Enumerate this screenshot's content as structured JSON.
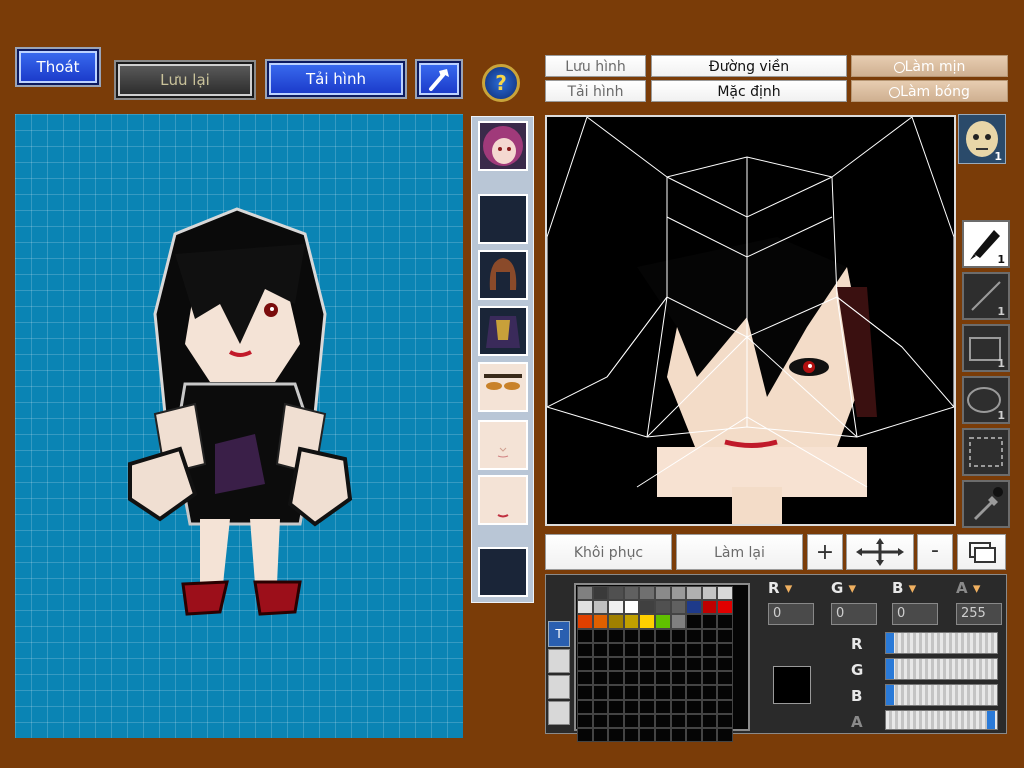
{
  "top_left_buttons": {
    "exit": "Thoát",
    "save": "Lưu lại",
    "load": "Tải hình"
  },
  "tool_buttons": {
    "save_image": "Lưu hình",
    "load_image": "Tải hình",
    "outline": "Đường viền",
    "default": "Mặc định",
    "smooth": "Làm mịn",
    "shade": "Làm bóng"
  },
  "edit_buttons": {
    "restore": "Khôi phục",
    "redo": "Làm lại",
    "plus": "+",
    "minus": "-"
  },
  "tool_sizes": {
    "pen": "1",
    "line": "1",
    "rect": "1",
    "ellipse": "1",
    "face_badge": "1"
  },
  "color_channels": {
    "r": "0",
    "g": "0",
    "b": "0",
    "a": "255"
  },
  "channel_labels": {
    "r": "R",
    "g": "G",
    "b": "B",
    "a": "A"
  },
  "palette_tab_label": "T",
  "colors": {
    "background": "#7a3c08",
    "preview_blue": "#0a84b4",
    "current_color": "#000000"
  },
  "palette": [
    "#808080",
    "#3a3a3a",
    "#505050",
    "#606060",
    "#707070",
    "#8a8a8a",
    "#9a9a9a",
    "#b0b0b0",
    "#c4c4c4",
    "#d8d8d8",
    "#e0e0e0",
    "#c0c0c0",
    "#f0f0f0",
    "#ffffff",
    "#404040",
    "#505050",
    "#606060",
    "#1e3a8a",
    "#c00000",
    "#e00000",
    "#e04000",
    "#e06000",
    "#a08000",
    "#c0a000",
    "#ffd000",
    "#60c000",
    "#808080"
  ],
  "slider_levels": {
    "r": 0,
    "g": 0,
    "b": 0,
    "a": 1
  }
}
